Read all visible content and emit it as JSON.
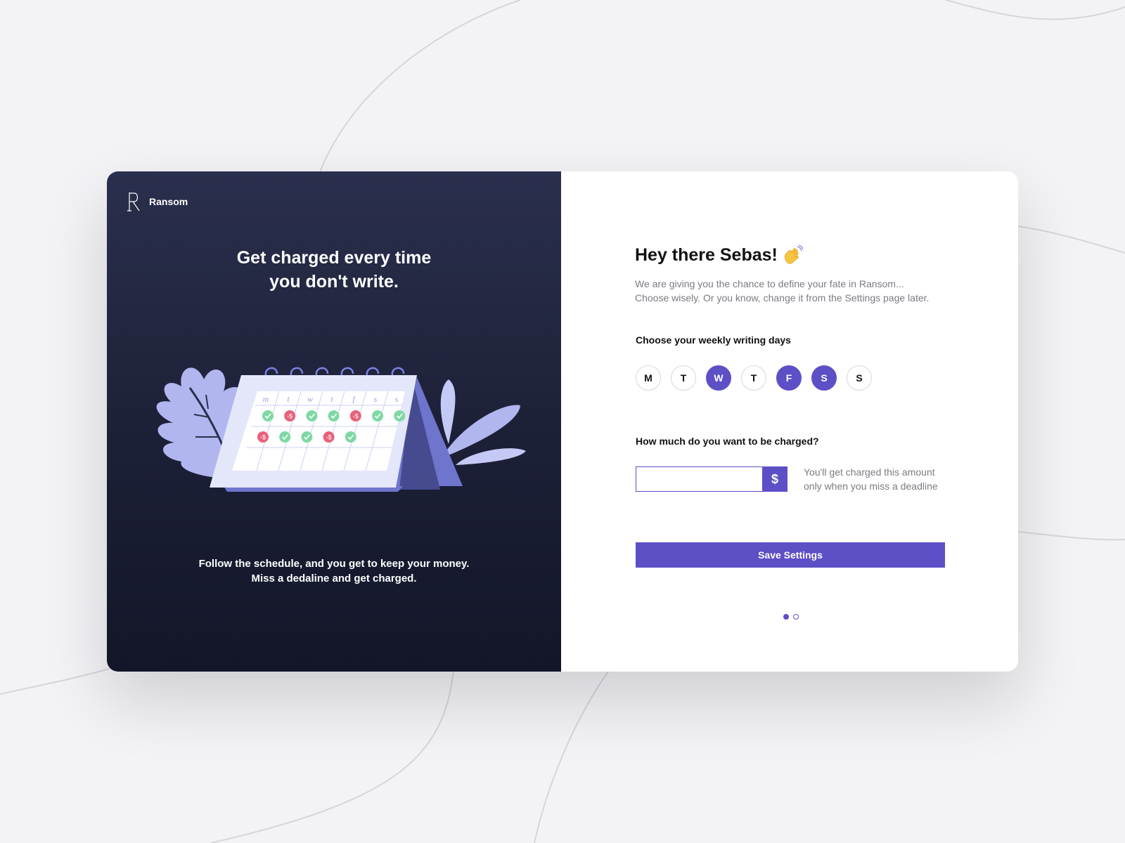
{
  "brand": {
    "name": "Ransom"
  },
  "left": {
    "headline": [
      "Get charged every time",
      "you don't write."
    ],
    "caption": [
      "Follow the schedule, and you get to keep your money.",
      "Miss a dedaline and get charged."
    ],
    "calendar": {
      "day_letters": [
        "m",
        "t",
        "w",
        "t",
        "f",
        "s",
        "s"
      ],
      "marks": [
        [
          "check",
          "dollar",
          "check",
          "check",
          "dollar",
          "check",
          "check"
        ],
        [
          "dollar",
          "check",
          "check",
          "dollar",
          "check",
          "",
          ""
        ]
      ],
      "dollar_glyph": "-$",
      "check_color": "#7fd8a4",
      "dollar_color": "#e8607a"
    }
  },
  "right": {
    "greeting": "Hey there Sebas!",
    "greeting_icon": "waving-hand-icon",
    "subtitle": [
      "We are giving you the chance to define your fate in Ransom...",
      "Choose wisely. Or  you know, change it from the Settings page later."
    ],
    "days_label": "Choose your weekly writing days",
    "days": [
      {
        "label": "M",
        "selected": false
      },
      {
        "label": "T",
        "selected": false
      },
      {
        "label": "W",
        "selected": true
      },
      {
        "label": "T",
        "selected": false
      },
      {
        "label": "F",
        "selected": true
      },
      {
        "label": "S",
        "selected": true
      },
      {
        "label": "S",
        "selected": false
      }
    ],
    "amount_label": "How much do you want to be charged?",
    "amount_value": "",
    "amount_placeholder": "",
    "currency_symbol": "$",
    "amount_hint": [
      "You'll get charged this amount",
      "only when you miss a deadline"
    ],
    "save_label": "Save Settings",
    "pagination": {
      "total": 2,
      "current": 1
    }
  },
  "colors": {
    "accent": "#5d4fc6",
    "dark_panel": "#1d2138",
    "background": "#f3f3f5"
  }
}
